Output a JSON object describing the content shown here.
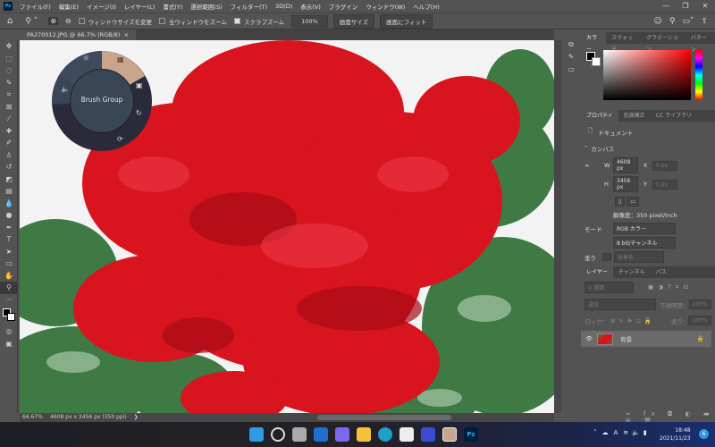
{
  "app": {
    "logo": "Ps"
  },
  "menu": [
    "ファイル(F)",
    "編集(E)",
    "イメージ(I)",
    "レイヤー(L)",
    "書式(Y)",
    "選択範囲(S)",
    "フィルター(T)",
    "3D(D)",
    "表示(V)",
    "プラグイン",
    "ウィンドウ(W)",
    "ヘルプ(H)"
  ],
  "window_controls": {
    "minimize": "—",
    "restore": "❐",
    "close": "✕"
  },
  "options": {
    "resize_windows": "ウィンドウサイズを変更",
    "zoom_all": "全ウィンドウをズーム",
    "scrubby_zoom": "スクラブズーム",
    "zoom_value": "100%",
    "fit_size": "画面サイズ",
    "fit_screen": "画面にフィット",
    "resize_checked": false,
    "zoom_all_checked": false,
    "scrubby_checked": true
  },
  "document_tab": {
    "title": "PA270012.JPG @ 66.7% (RGB/8)",
    "close": "×"
  },
  "radial_menu": {
    "label": "Brush Group"
  },
  "status": {
    "zoom": "66.67%",
    "info": "4608 px x 3456 px (350 ppi)",
    "arrow": "❯"
  },
  "color_panel": {
    "tabs": [
      "カラー",
      "スウォッチ",
      "グラデーション",
      "パターン"
    ]
  },
  "properties": {
    "tabs": [
      "プロパティ",
      "色調補正",
      "CC ライブラリ"
    ],
    "doc_label": "ドキュメント",
    "section": "カンバス",
    "w_label": "W",
    "w": "4608 px",
    "h_label": "H",
    "h": "3456 px",
    "x_label": "X",
    "x": "0 px",
    "y_label": "Y",
    "y": "0 px",
    "resolution": "解像度：350 pixel/inch",
    "mode_label": "モード",
    "mode": "RGB カラー",
    "depth": "8 bit/チャンネル",
    "fill_label": "塗り",
    "fill": "背景色"
  },
  "layers": {
    "tabs": [
      "レイヤー",
      "チャンネル",
      "パス"
    ],
    "filter": "種類",
    "blend": "通常",
    "opacity_label": "不透明度：",
    "opacity": "100%",
    "lock_label": "ロック：",
    "fill_label": "塗り：",
    "fill": "100%",
    "items": [
      {
        "name": "背景"
      }
    ]
  },
  "taskbar": {
    "time": "18:48",
    "date": "2021/11/23",
    "ime": "A",
    "notif": "6"
  },
  "colors": {
    "accent": "#31a8ff",
    "bg": "#535353"
  }
}
